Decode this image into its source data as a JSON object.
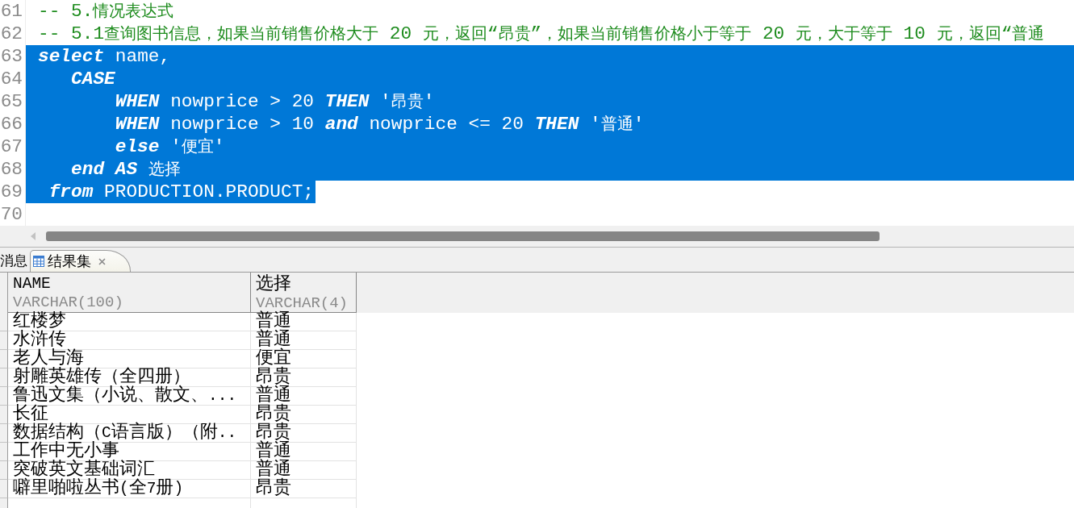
{
  "editor": {
    "lines": [
      {
        "number": "61",
        "selected": false,
        "tokens": [
          {
            "kind": "comment",
            "text": "-- 5.情况表达式"
          }
        ]
      },
      {
        "number": "62",
        "selected": false,
        "tokens": [
          {
            "kind": "comment",
            "text": "-- 5.1查询图书信息，如果当前销售价格大于 20 元，返回“昂贵”，如果当前销售价格小于等于 20 元，大于等于 10 元，返回“普通"
          }
        ]
      },
      {
        "number": "63",
        "selected": true,
        "tokens": [
          {
            "kind": "keyword",
            "text": "select"
          },
          {
            "kind": "plain",
            "text": " name,"
          }
        ]
      },
      {
        "number": "64",
        "selected": true,
        "tokens": [
          {
            "kind": "keyword",
            "text": "   CASE"
          }
        ]
      },
      {
        "number": "65",
        "selected": true,
        "tokens": [
          {
            "kind": "keyword",
            "text": "       WHEN"
          },
          {
            "kind": "plain",
            "text": " nowprice > 20 "
          },
          {
            "kind": "keyword",
            "text": "THEN"
          },
          {
            "kind": "plain",
            "text": " '昂贵'"
          }
        ]
      },
      {
        "number": "66",
        "selected": true,
        "tokens": [
          {
            "kind": "keyword",
            "text": "       WHEN"
          },
          {
            "kind": "plain",
            "text": " nowprice > 10 "
          },
          {
            "kind": "keyword",
            "text": "and"
          },
          {
            "kind": "plain",
            "text": " nowprice <= 20 "
          },
          {
            "kind": "keyword",
            "text": "THEN"
          },
          {
            "kind": "plain",
            "text": " '普通'"
          }
        ]
      },
      {
        "number": "67",
        "selected": true,
        "tokens": [
          {
            "kind": "keyword",
            "text": "       else"
          },
          {
            "kind": "plain",
            "text": " '便宜'"
          }
        ]
      },
      {
        "number": "68",
        "selected": true,
        "tokens": [
          {
            "kind": "keyword",
            "text": "   end"
          },
          {
            "kind": "keyword",
            "text": " AS"
          },
          {
            "kind": "plain",
            "text": " 选择"
          }
        ]
      },
      {
        "number": "69",
        "selected": true,
        "tokens": [
          {
            "kind": "keyword",
            "text": " from"
          },
          {
            "kind": "plain",
            "text": " PRODUCTION.PRODUCT;"
          }
        ]
      },
      {
        "number": "70",
        "selected": false
      }
    ]
  },
  "result_tabs": [
    {
      "label": "消息",
      "kind": "messages",
      "selected": false
    },
    {
      "label": "结果集",
      "kind": "result_set",
      "selected": true
    }
  ],
  "grid": {
    "columns": [
      {
        "name": "NAME",
        "type": "VARCHAR(100)"
      },
      {
        "name": "选择",
        "type": "VARCHAR(4)"
      }
    ],
    "rows": [
      {
        "cells": [
          "红楼梦",
          "普通"
        ]
      },
      {
        "cells": [
          "水浒传",
          "普通"
        ]
      },
      {
        "cells": [
          "老人与海",
          "便宜"
        ]
      },
      {
        "cells": [
          "射雕英雄传（全四册）",
          "昂贵"
        ]
      },
      {
        "cells": [
          "鲁迅文集（小说、散文、...",
          "普通"
        ]
      },
      {
        "cells": [
          "长征",
          "昂贵"
        ]
      },
      {
        "cells": [
          "数据结构（C语言版）（附..",
          "昂贵"
        ]
      },
      {
        "cells": [
          "工作中无小事",
          "普通"
        ]
      },
      {
        "cells": [
          "突破英文基础词汇",
          "普通"
        ]
      },
      {
        "cells": [
          "噼里啪啦丛书(全7册)",
          "昂贵"
        ]
      }
    ]
  }
}
